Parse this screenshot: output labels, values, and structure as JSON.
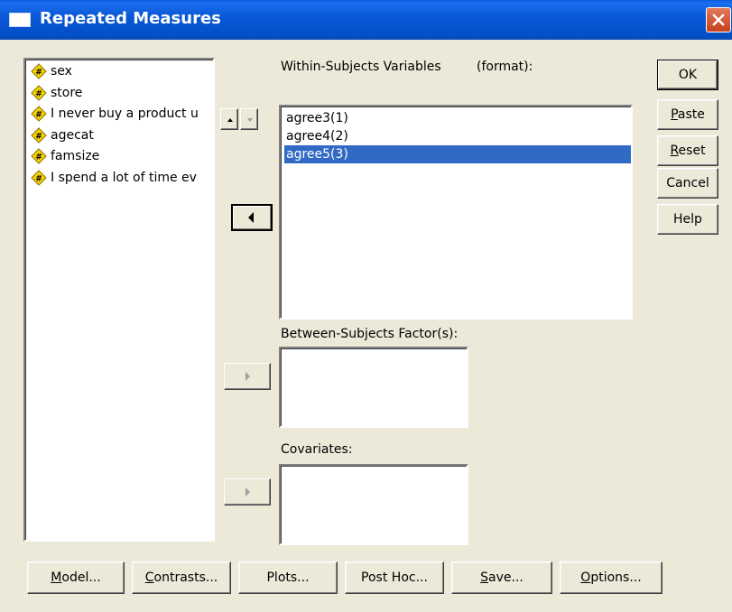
{
  "window": {
    "title": "Repeated Measures"
  },
  "source_variables": [
    "sex",
    "store",
    "I never buy a product u",
    "agecat",
    "famsize",
    "I spend a lot of time ev"
  ],
  "within_subjects": {
    "label": "Within-Subjects Variables",
    "format_label": "(format):",
    "items": [
      "agree3(1)",
      "agree4(2)",
      "agree5(3)"
    ],
    "selected_index": 2
  },
  "between_subjects": {
    "label": "Between-Subjects Factor(s):"
  },
  "covariates": {
    "label": "Covariates:"
  },
  "side_buttons": {
    "ok": "OK",
    "paste": "Paste",
    "reset": "Reset",
    "cancel": "Cancel",
    "help": "Help"
  },
  "bottom_buttons": {
    "model": "Model...",
    "contrasts": "Contrasts...",
    "plots": "Plots...",
    "post_hoc": "Post Hoc...",
    "save": "Save...",
    "options": "Options..."
  },
  "icons": {
    "variable": "numeric-variable-icon",
    "move_left": "arrow-left-icon",
    "move_right": "arrow-right-icon",
    "move_up": "arrow-up-icon",
    "move_down": "arrow-down-icon",
    "close": "close-icon"
  }
}
